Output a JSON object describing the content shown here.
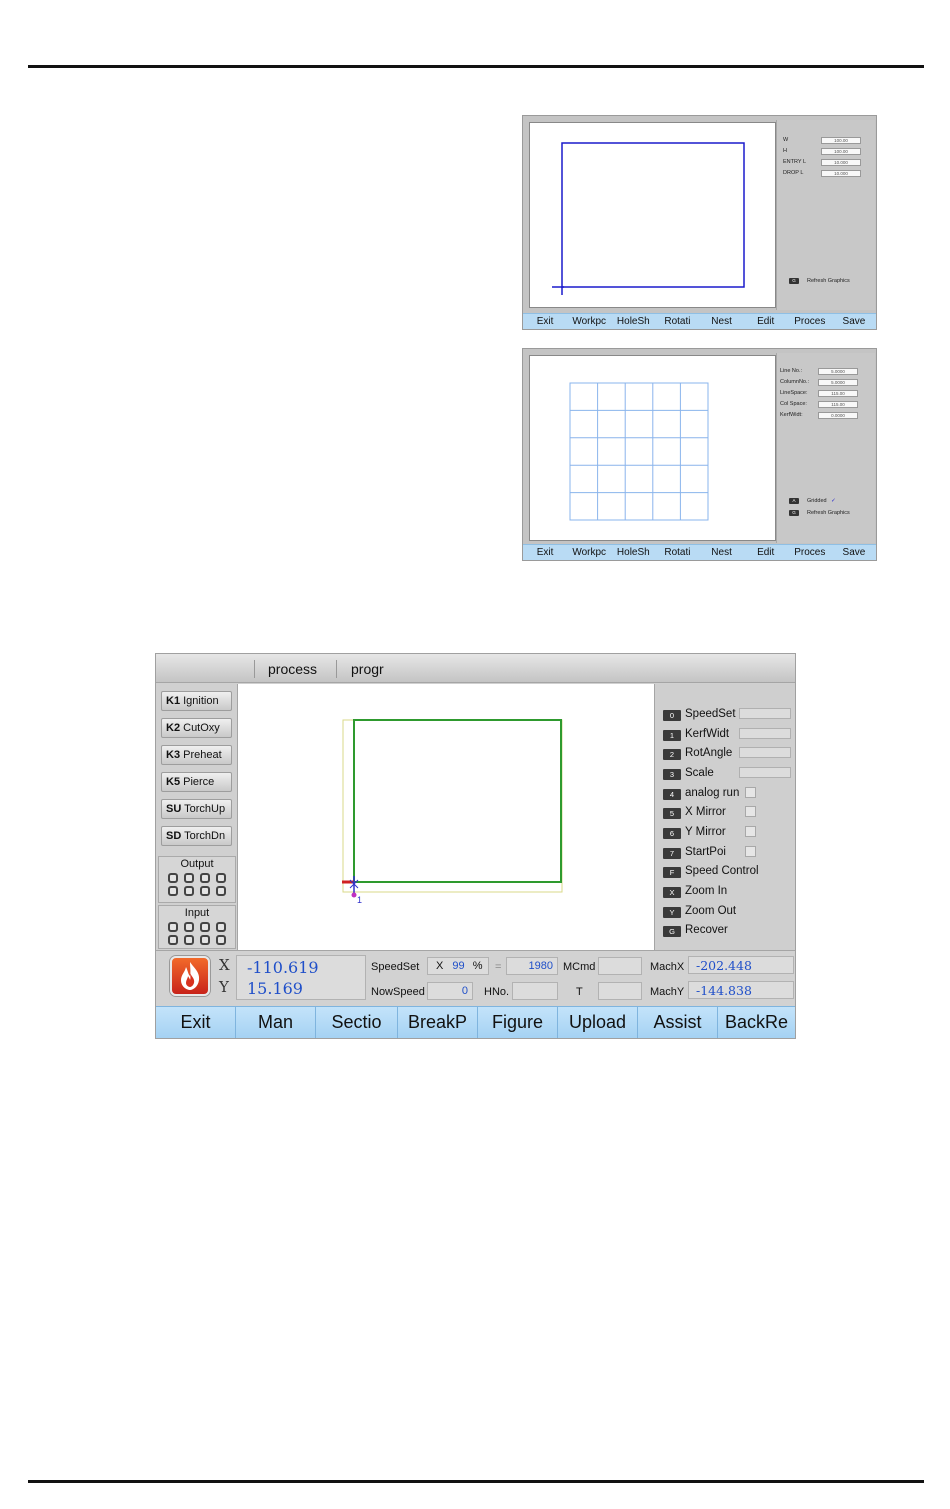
{
  "screen1": {
    "params": [
      {
        "label": "W",
        "value": "100.00"
      },
      {
        "label": "H",
        "value": "100.00"
      },
      {
        "label": "ENTRY L",
        "value": "10.000"
      },
      {
        "label": "DROP L",
        "value": "10.000"
      }
    ],
    "refresh": {
      "key": "G",
      "label": "Refresh Graphics"
    },
    "menu": [
      "Exit",
      "Workpc",
      "HoleSh",
      "Rotati",
      "Nest",
      "Edit",
      "Proces",
      "Save"
    ]
  },
  "screen2": {
    "params": [
      {
        "label": "Line No.:",
        "value": "5.0000"
      },
      {
        "label": "ColumnNo.:",
        "value": "5.0000"
      },
      {
        "label": "LineSpace:",
        "value": "115.00"
      },
      {
        "label": "Col Space:",
        "value": "115.00"
      },
      {
        "label": "KerfWidt:",
        "value": "0.0000"
      }
    ],
    "gridded": {
      "key": "A",
      "label": "Gridded",
      "mark": "✓"
    },
    "refresh": {
      "key": "G",
      "label": "Refresh Graphics"
    },
    "menu": [
      "Exit",
      "Workpc",
      "HoleSh",
      "Rotati",
      "Nest",
      "Edit",
      "Proces",
      "Save"
    ]
  },
  "main": {
    "tabs": [
      "process",
      "progr"
    ],
    "left_buttons": [
      {
        "key": "K1",
        "label": "Ignition"
      },
      {
        "key": "K2",
        "label": "CutOxy"
      },
      {
        "key": "K3",
        "label": "Preheat"
      },
      {
        "key": "K5",
        "label": "Pierce"
      },
      {
        "key": "SU",
        "label": "TorchUp"
      },
      {
        "key": "SD",
        "label": "TorchDn"
      }
    ],
    "output_label": "Output",
    "input_label": "Input",
    "right_items": [
      {
        "key": "0",
        "label": "SpeedSet",
        "control": "field"
      },
      {
        "key": "1",
        "label": "KerfWidt",
        "control": "field"
      },
      {
        "key": "2",
        "label": "RotAngle",
        "control": "field"
      },
      {
        "key": "3",
        "label": "Scale",
        "control": "field"
      },
      {
        "key": "4",
        "label": "analog run",
        "control": "check"
      },
      {
        "key": "5",
        "label": "X Mirror",
        "control": "check"
      },
      {
        "key": "6",
        "label": "Y Mirror",
        "control": "check"
      },
      {
        "key": "7",
        "label": "StartPoi",
        "control": "check"
      },
      {
        "key": "F",
        "label": "Speed Control",
        "control": "none"
      },
      {
        "key": "X",
        "label": "Zoom In",
        "control": "none"
      },
      {
        "key": "Y",
        "label": "Zoom Out",
        "control": "none"
      },
      {
        "key": "G",
        "label": "Recover",
        "control": "none"
      }
    ],
    "viewport_label": "1",
    "status": {
      "x_axis": "X",
      "y_axis": "Y",
      "x_value": "-110.619",
      "y_value": "15.169",
      "speedset_label": "SpeedSet",
      "speed_x": "X",
      "speed_pct": "99",
      "pct_sign": "%",
      "eq": "=",
      "speed_value": "1980",
      "mcmd_label": "MCmd",
      "nowspeed_label": "NowSpeed",
      "nowspeed_value": "0",
      "hno_label": "HNo.",
      "t_label": "T",
      "machx_label": "MachX",
      "machx_value": "-202.448",
      "machy_label": "MachY",
      "machy_value": "-144.838"
    },
    "fkeys": [
      "Exit",
      "Man",
      "Sectio",
      "BreakP",
      "Figure",
      "Upload",
      "Assist",
      "BackRe"
    ]
  },
  "colors": {
    "shape_blue": "#1a1acc",
    "grid_blue": "#8ab4ec",
    "path_green": "#2e9a2e",
    "path_yellow": "#dada88",
    "value_blue": "#1f4fc9",
    "fkey_bg": "#b9dbf4"
  }
}
